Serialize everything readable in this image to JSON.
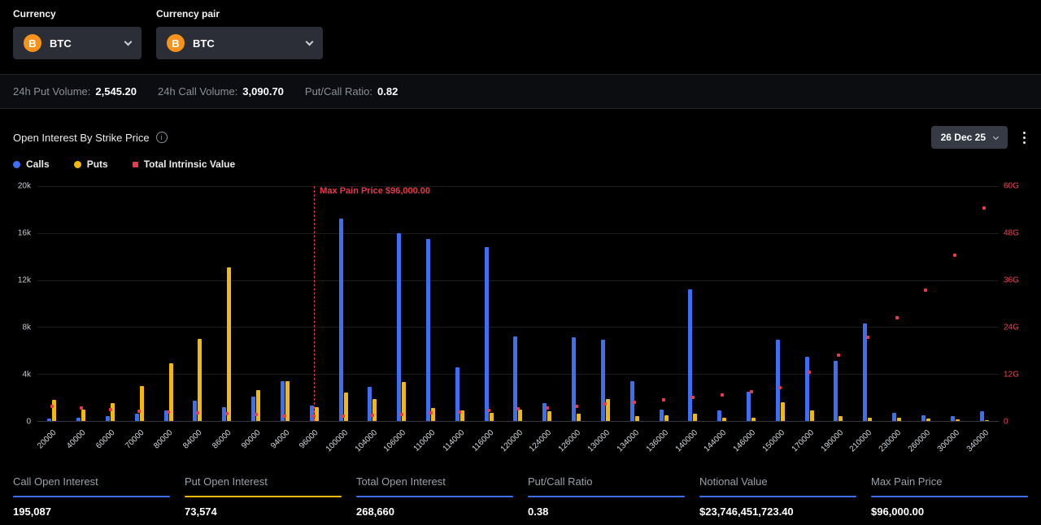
{
  "filters": {
    "currency": {
      "label": "Currency",
      "value": "BTC",
      "icon_text": "B"
    },
    "currency_pair": {
      "label": "Currency pair",
      "value": "BTC",
      "icon_text": "B"
    }
  },
  "volume_stats": [
    {
      "label": "24h Put Volume:",
      "value": "2,545.20"
    },
    {
      "label": "24h Call Volume:",
      "value": "3,090.70"
    },
    {
      "label": "Put/Call Ratio:",
      "value": "0.82"
    }
  ],
  "section": {
    "title": "Open Interest By Strike Price",
    "info_icon": "i",
    "date_filter": "26 Dec 25"
  },
  "legend": [
    {
      "label": "Calls",
      "color": "#3d6ff2",
      "shape": "circle"
    },
    {
      "label": "Puts",
      "color": "#f0b90b",
      "shape": "circle"
    },
    {
      "label": "Total Intrinsic Value",
      "color": "#ea3b4e",
      "shape": "square"
    }
  ],
  "chart_data": {
    "type": "bar",
    "title": "Open Interest By Strike Price",
    "categories": [
      20000,
      40000,
      60000,
      70000,
      80000,
      84000,
      86000,
      90000,
      94000,
      96000,
      100000,
      104000,
      106000,
      110000,
      114000,
      116000,
      120000,
      124000,
      126000,
      130000,
      134000,
      136000,
      140000,
      144000,
      146000,
      150000,
      170000,
      190000,
      210000,
      230000,
      260000,
      300000,
      340000
    ],
    "series": [
      {
        "name": "Calls",
        "type": "bar",
        "color": "#3d6ff2",
        "values": [
          200,
          300,
          400,
          600,
          900,
          1700,
          1200,
          2100,
          3400,
          1300,
          17200,
          2900,
          16000,
          15500,
          4600,
          14800,
          7200,
          1500,
          7100,
          6900,
          3400,
          1000,
          11200,
          900,
          2500,
          6900,
          5500,
          5100,
          8300,
          700,
          500,
          400,
          800
        ]
      },
      {
        "name": "Puts",
        "type": "bar",
        "color": "#f0b90b",
        "values": [
          1800,
          1000,
          1500,
          3000,
          4900,
          7000,
          13100,
          2600,
          3400,
          1200,
          2400,
          1900,
          3300,
          1100,
          900,
          700,
          1000,
          800,
          600,
          1900,
          400,
          500,
          600,
          300,
          250,
          1600,
          900,
          400,
          300,
          250,
          200,
          150,
          100
        ]
      },
      {
        "name": "Total Intrinsic Value",
        "type": "scatter",
        "axis": "right",
        "color": "#ea3b4e",
        "values_g": [
          3.4,
          2.9,
          2.4,
          2.1,
          1.8,
          1.6,
          1.5,
          1.2,
          0.9,
          0.8,
          0.9,
          1.1,
          1.3,
          1.6,
          1.9,
          2.2,
          2.6,
          3.0,
          3.4,
          3.9,
          4.4,
          4.9,
          5.6,
          6.3,
          7.0,
          8.0,
          12.0,
          16.5,
          21.0,
          26.0,
          33.0,
          42.0,
          54.0
        ]
      }
    ],
    "left_axis": {
      "ticks": [
        "0",
        "4k",
        "8k",
        "12k",
        "16k",
        "20k"
      ],
      "max": 20000
    },
    "right_axis": {
      "ticks": [
        "0",
        "12G",
        "24G",
        "36G",
        "48G",
        "60G"
      ],
      "max": 60,
      "color": "#ef4456"
    },
    "max_pain": {
      "label": "Max Pain Price $96,000.00",
      "strike": 96000
    },
    "grid": true,
    "legend_position": "top-left"
  },
  "summary": [
    {
      "label": "Call Open Interest",
      "value": "195,087",
      "accent": "#3d6ff2"
    },
    {
      "label": "Put Open Interest",
      "value": "73,574",
      "accent": "#f0b90b"
    },
    {
      "label": "Total Open Interest",
      "value": "268,660",
      "accent": "#3d6ff2"
    },
    {
      "label": "Put/Call Ratio",
      "value": "0.38",
      "accent": "#3d6ff2"
    },
    {
      "label": "Notional Value",
      "value": "$23,746,451,723.40",
      "accent": "#3d6ff2"
    },
    {
      "label": "Max Pain Price",
      "value": "$96,000.00",
      "accent": "#3d6ff2"
    }
  ]
}
